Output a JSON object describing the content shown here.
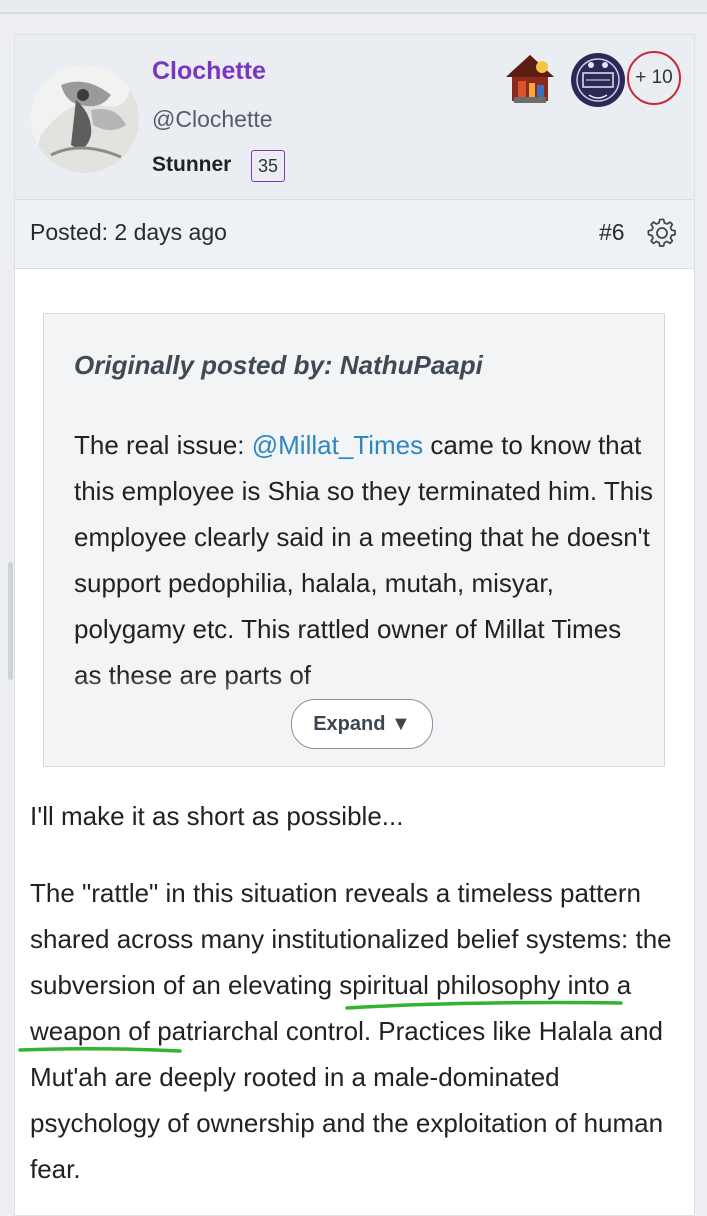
{
  "user": {
    "name": "Clochette",
    "handle": "@Clochette",
    "rank": "Stunner",
    "level": "35",
    "extra_badges": "+ 10"
  },
  "post": {
    "posted_label": "Posted: 2 days ago",
    "number": "#6"
  },
  "quote": {
    "title": "Originally posted by: NathuPaapi",
    "text_before_mention": "The real issue: ",
    "mention": "@Millat_Times",
    "text_after_mention": " came to know that this employee is Shia so they terminated him. This employee clearly said in a meeting that he doesn't support pedophilia, halala, mutah, misyar, polygamy etc. This rattled owner of Millat Times as these are parts of",
    "expand_label": "Expand ▼"
  },
  "reply": {
    "intro": "I'll make it as short as possible...",
    "body": "The \"rattle\" in this situation reveals a timeless pattern shared across many institutionalized belief systems: the subversion of an elevating spiritual philosophy into a weapon of patriarchal control. Practices like Halala and Mut'ah are deeply rooted in a male-dominated psychology of ownership and the exploitation of human fear."
  },
  "colors": {
    "username": "#7a35c2",
    "mention": "#2e86c1",
    "plus_badge_border": "#c8283a",
    "annotation_underline": "#2fb52f"
  },
  "icons": {
    "settings": "gear-icon",
    "avatar": "avatar-image",
    "badges": [
      "house-badge-icon",
      "sticker-badge-icon"
    ]
  }
}
